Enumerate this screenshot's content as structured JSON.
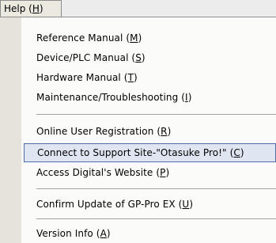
{
  "menu": {
    "title": "Help (",
    "title_key": "H",
    "title_end": ")"
  },
  "items": [
    {
      "label": "Reference Manual (",
      "key": "M",
      "end": ")"
    },
    {
      "label": "Device/PLC Manual (",
      "key": "S",
      "end": ")"
    },
    {
      "label": "Hardware Manual (",
      "key": "T",
      "end": ")"
    },
    {
      "label": "Maintenance/Troubleshooting (",
      "key": "I",
      "end": ")"
    },
    {
      "label": "Online User Registration (",
      "key": "R",
      "end": ")"
    },
    {
      "label": "Connect to Support Site-\"Otasuke Pro!\" (",
      "key": "C",
      "end": ")"
    },
    {
      "label": "Access Digital's Website (",
      "key": "P",
      "end": ")"
    },
    {
      "label": "Confirm Update of GP-Pro EX (",
      "key": "U",
      "end": ")"
    },
    {
      "label": "Version Info (",
      "key": "A",
      "end": ")"
    }
  ]
}
